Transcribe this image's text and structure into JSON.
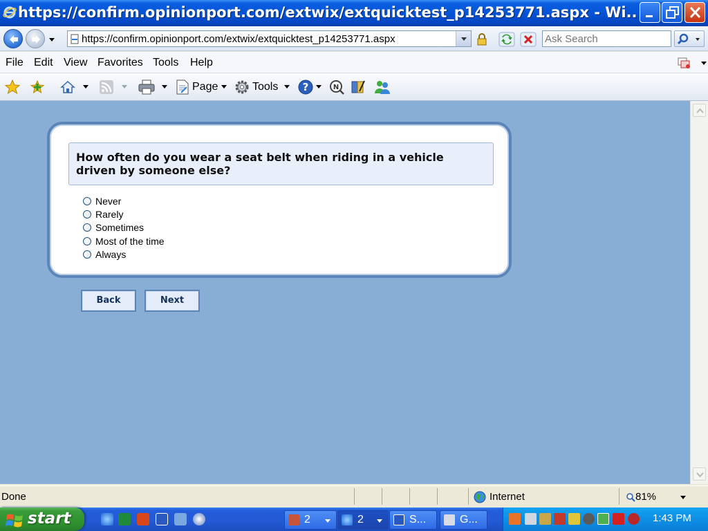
{
  "window": {
    "title": "https://confirm.opinionport.com/extwix/extquicktest_p14253771.aspx - Wi..."
  },
  "address_bar": {
    "url": "https://confirm.opinionport.com/extwix/extquicktest_p14253771.aspx"
  },
  "search": {
    "placeholder": "Ask Search"
  },
  "menu": {
    "items": [
      "File",
      "Edit",
      "View",
      "Favorites",
      "Tools",
      "Help"
    ]
  },
  "command_bar": {
    "page_label": "Page",
    "tools_label": "Tools"
  },
  "survey": {
    "question": "How often do you wear a seat belt when riding in a vehicle driven by someone else?",
    "options": [
      "Never",
      "Rarely",
      "Sometimes",
      "Most of the time",
      "Always"
    ],
    "back_label": "Back",
    "next_label": "Next"
  },
  "status_bar": {
    "status": "Done",
    "zone": "Internet",
    "zoom": "81%"
  },
  "taskbar": {
    "start_label": "start",
    "tasks": [
      {
        "label": "2"
      },
      {
        "label": "2"
      },
      {
        "label": "S..."
      },
      {
        "label": "G..."
      }
    ],
    "clock": "1:43 PM"
  },
  "colors": {
    "content_background": "#88aed6",
    "panel_border": "#5b85b8",
    "question_background": "#e8effa"
  }
}
